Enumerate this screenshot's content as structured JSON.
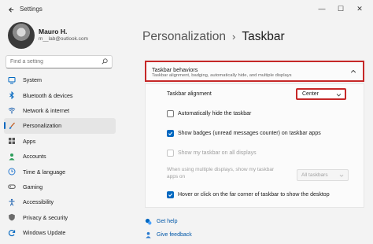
{
  "window": {
    "title": "Settings",
    "minimize": "—",
    "maximize": "☐",
    "close": "✕"
  },
  "user": {
    "name": "Mauro H.",
    "email": "m__lab@outlook.com"
  },
  "search": {
    "placeholder": "Find a setting"
  },
  "sidebar": {
    "items": [
      {
        "label": "System",
        "icon": "monitor-icon"
      },
      {
        "label": "Bluetooth & devices",
        "icon": "bluetooth-icon"
      },
      {
        "label": "Network & internet",
        "icon": "wifi-icon"
      },
      {
        "label": "Personalization",
        "icon": "brush-icon",
        "active": true
      },
      {
        "label": "Apps",
        "icon": "apps-icon"
      },
      {
        "label": "Accounts",
        "icon": "person-icon"
      },
      {
        "label": "Time & language",
        "icon": "globe-clock-icon"
      },
      {
        "label": "Gaming",
        "icon": "gamepad-icon"
      },
      {
        "label": "Accessibility",
        "icon": "accessibility-icon"
      },
      {
        "label": "Privacy & security",
        "icon": "shield-icon"
      },
      {
        "label": "Windows Update",
        "icon": "update-icon"
      }
    ]
  },
  "breadcrumb": {
    "parent": "Personalization",
    "separator": "›",
    "current": "Taskbar"
  },
  "taskbar_behaviors": {
    "title": "Taskbar behaviors",
    "subtitle": "Taskbar alignment, badging, automatically hide, and multiple displays",
    "alignment": {
      "label": "Taskbar alignment",
      "value": "Center"
    },
    "options": [
      {
        "label": "Automatically hide the taskbar",
        "checked": false,
        "disabled": false
      },
      {
        "label": "Show badges (unread messages counter) on taskbar apps",
        "checked": true,
        "disabled": false
      },
      {
        "label": "Show my taskbar on all displays",
        "checked": false,
        "disabled": true
      }
    ],
    "multi_display": {
      "label_line1": "When using multiple displays, show my taskbar",
      "label_line2": "apps on",
      "value": "All taskbars"
    },
    "far_corner": {
      "label": "Hover or click on the far corner of taskbar to show the desktop",
      "checked": true
    }
  },
  "links": {
    "help": "Get help",
    "feedback": "Give feedback"
  },
  "colors": {
    "accent": "#0067c0",
    "highlight_border": "#c62828"
  }
}
